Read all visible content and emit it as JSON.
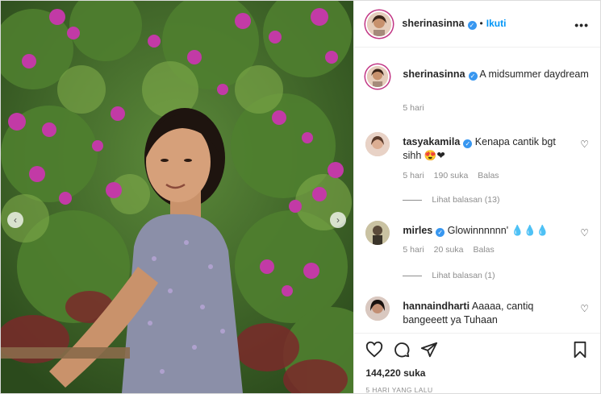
{
  "post": {
    "author": "sherinasinna",
    "verified": true,
    "follow_label": "Ikuti",
    "more_icon": "more-options-icon",
    "caption": "A midsummer daydream",
    "caption_time": "5 hari",
    "likes": "144,220 suka",
    "posted": "5 HARI YANG LALU"
  },
  "comments": [
    {
      "user": "tasyakamila",
      "text": "Kenapa cantik bgt sihh 😍❤",
      "time": "5 hari",
      "likes": "190 suka",
      "reply_label": "Balas",
      "view_replies": "Lihat balasan (13)"
    },
    {
      "user": "mirles",
      "text": "Glowinnnnnn' 💧💧💧",
      "time": "5 hari",
      "likes": "20 suka",
      "reply_label": "Balas",
      "view_replies": "Lihat balasan (1)"
    },
    {
      "user": "hannaindharti",
      "text": "Aaaaa, cantiq bangeeett ya Tuhaan"
    }
  ],
  "colors": {
    "link": "#0095f6",
    "verified": "#3897f0",
    "muted": "#8e8e8e",
    "text": "#262626"
  }
}
